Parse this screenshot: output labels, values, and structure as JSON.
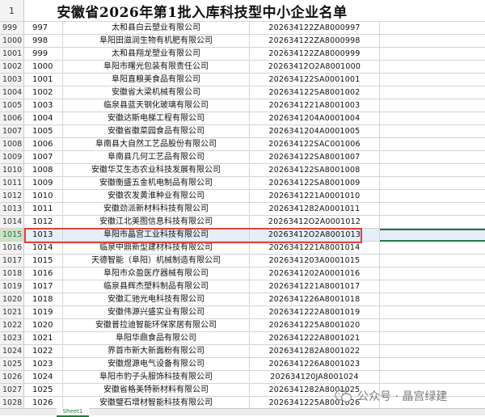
{
  "sheet": {
    "title": "安徽省2026年第1批入库科技型中小企业名单",
    "title_row_number": "1",
    "rows": [
      {
        "row": "999",
        "seq": "997",
        "name": "太和县白云塑业有限公司",
        "code": "202634122ZA8000997"
      },
      {
        "row": "1000",
        "seq": "998",
        "name": "阜阳田滋润生物有机肥有限公司",
        "code": "202634122ZA8000998"
      },
      {
        "row": "1001",
        "seq": "999",
        "name": "太和县翔龙塑业有限公司",
        "code": "202634122ZA8000999"
      },
      {
        "row": "1002",
        "seq": "1000",
        "name": "阜阳市曙光包装有限责任公司",
        "code": "20263412O2A8001000"
      },
      {
        "row": "1003",
        "seq": "1001",
        "name": "阜阳直粮美食品有限公司",
        "code": "202634122SA0001001"
      },
      {
        "row": "1004",
        "seq": "1002",
        "name": "安徽省大梁机械有限公司",
        "code": "202634122SA8001002"
      },
      {
        "row": "1005",
        "seq": "1003",
        "name": "临泉县蓝天钢化玻璃有限公司",
        "code": "2026341221A8001003"
      },
      {
        "row": "1006",
        "seq": "1004",
        "name": "安徽达斯电梯工程有限公司",
        "code": "2026341204A0001004"
      },
      {
        "row": "1007",
        "seq": "1005",
        "name": "安徽省徽菜园食品有限公司",
        "code": "2026341204A0001005"
      },
      {
        "row": "1008",
        "seq": "1006",
        "name": "阜南县大自然工艺品股份有限公司",
        "code": "202634122SAC001006"
      },
      {
        "row": "1009",
        "seq": "1007",
        "name": "阜南县几何工艺品有限公司",
        "code": "202634122SA8001007"
      },
      {
        "row": "1010",
        "seq": "1008",
        "name": "安徽华艾生态农业科技发展有限公司",
        "code": "202634122SA8001008"
      },
      {
        "row": "1011",
        "seq": "1009",
        "name": "安徽衡盛五金机电制品有限公司",
        "code": "202634122SA8001009"
      },
      {
        "row": "1012",
        "seq": "1010",
        "name": "安徽农发黄淮种业有限公司",
        "code": "2026341221A0001010"
      },
      {
        "row": "1013",
        "seq": "1011",
        "name": "安徽劲派新材料科技有限公司",
        "code": "2026341282A0001011"
      },
      {
        "row": "1014",
        "seq": "1012",
        "name": "安徽江北美图信息科技有限公司",
        "code": "20263412O2A0001012"
      },
      {
        "row": "1015",
        "seq": "1013",
        "name": "阜阳市晶宫工业科技有限公司",
        "code": "20263412O2A8001013"
      },
      {
        "row": "1016",
        "seq": "1014",
        "name": "临泉中鼎新型建材科技有限公司",
        "code": "2026341221A8001014"
      },
      {
        "row": "1017",
        "seq": "1015",
        "name": "天德智能（阜阳）机械制造有限公司",
        "code": "2026341203A0001015"
      },
      {
        "row": "1018",
        "seq": "1016",
        "name": "阜阳市众盈医疗器械有限公司",
        "code": "2026341202A0001016"
      },
      {
        "row": "1019",
        "seq": "1017",
        "name": "临泉县辉杰塑料制品有限公司",
        "code": "2026341221A8001017"
      },
      {
        "row": "1020",
        "seq": "1018",
        "name": "安徽汇驰光电科技有限公司",
        "code": "2026341226A8001018"
      },
      {
        "row": "1021",
        "seq": "1019",
        "name": "安徽伟源兴盛实业有限公司",
        "code": "2026341222A8001019"
      },
      {
        "row": "1022",
        "seq": "1020",
        "name": "安徽普拉迪智能环保家居有限公司",
        "code": "2026341225A8001020"
      },
      {
        "row": "1023",
        "seq": "1021",
        "name": "阜阳华鼎食品有限公司",
        "code": "2026341222A8001021"
      },
      {
        "row": "1024",
        "seq": "1022",
        "name": "界首市新大新面粉有限公司",
        "code": "2026341282A8001022"
      },
      {
        "row": "1025",
        "seq": "1023",
        "name": "安徽煜源电气设备有限公司",
        "code": "2026341226A8001023"
      },
      {
        "row": "1026",
        "seq": "1024",
        "name": "阜阳市豹子头服饰科技有限公司",
        "code": "202634120JA8001024"
      },
      {
        "row": "1027",
        "seq": "1025",
        "name": "安徽省格美特新材料有限公司",
        "code": "2026341282A8001025"
      },
      {
        "row": "1028",
        "seq": "1026",
        "name": "安徽璧石增材智能科技有限公司",
        "code": "2026341225A8001026"
      }
    ],
    "highlighted_row": "1015"
  },
  "tabs": {
    "active_label": "Sheet1"
  },
  "watermark": {
    "text": "公众号 · 晶宫绿建"
  },
  "colors": {
    "highlight_border": "#e0433a",
    "selection_green": "#1f7a3a"
  }
}
